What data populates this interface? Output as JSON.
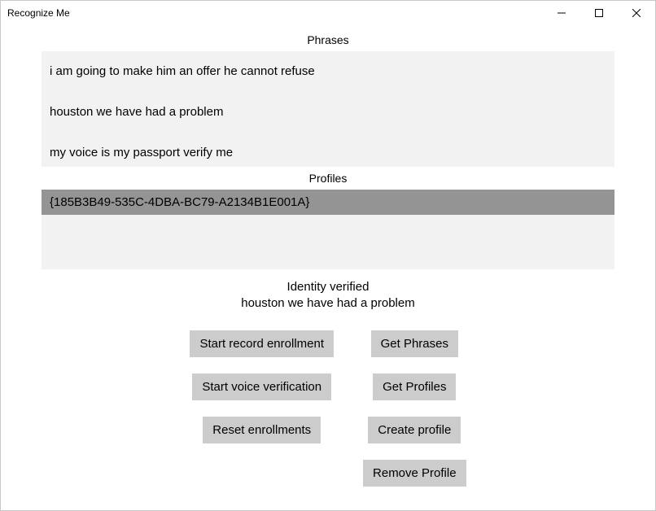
{
  "window": {
    "title": "Recognize Me"
  },
  "sections": {
    "phrases_label": "Phrases",
    "profiles_label": "Profiles"
  },
  "phrases": [
    "i am going to make him an offer he cannot refuse",
    "houston we have had a problem",
    "my voice is my passport verify me"
  ],
  "profiles": [
    {
      "id": "{185B3B49-535C-4DBA-BC79-A2134B1E001A}",
      "selected": true
    }
  ],
  "status": {
    "line1": "Identity verified",
    "line2": "houston we have had a problem"
  },
  "buttons": {
    "start_record": "Start record enrollment",
    "start_verify": "Start voice verification",
    "reset_enroll": "Reset enrollments",
    "get_phrases": "Get Phrases",
    "get_profiles": "Get Profiles",
    "create_profile": "Create profile",
    "remove_profile": "Remove Profile"
  }
}
